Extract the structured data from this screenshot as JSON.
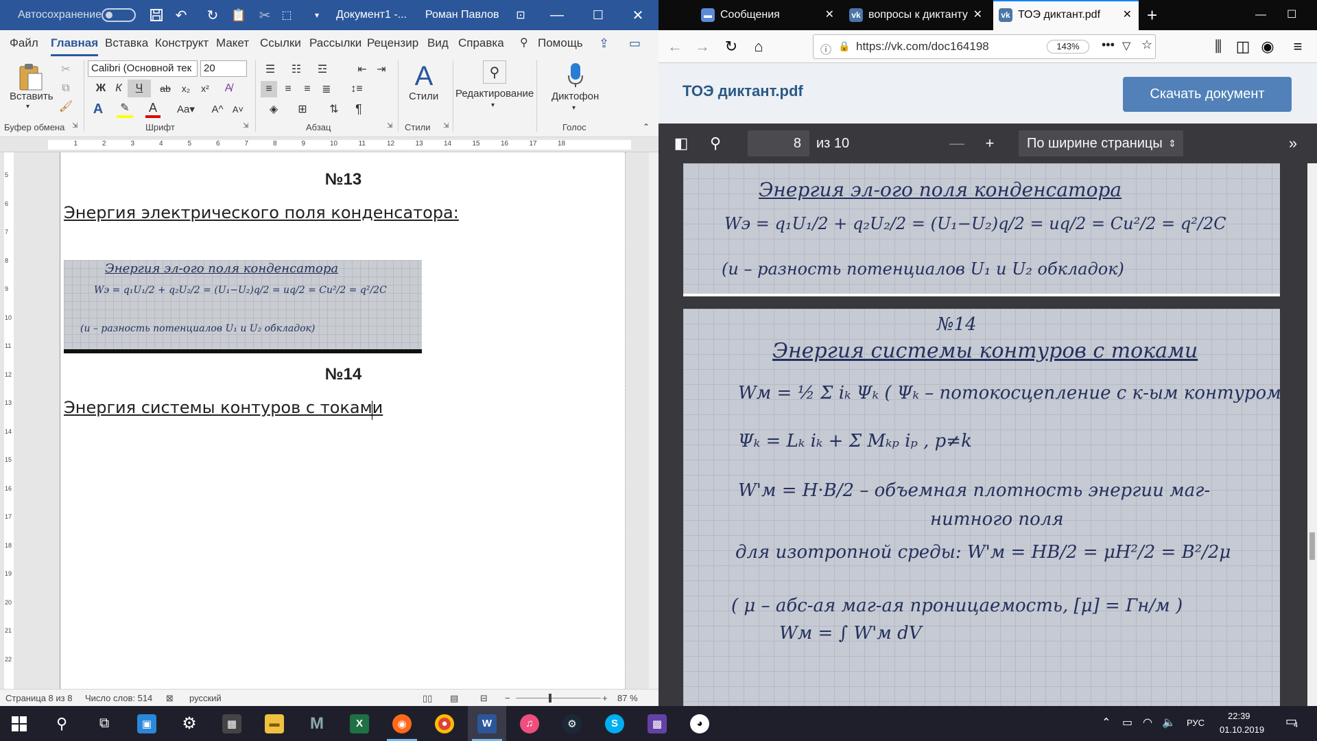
{
  "word": {
    "autosave_label": "Автосохранение",
    "doc_title": "Документ1  -...",
    "user_name": "Роман Павлов",
    "tabs": [
      "Файл",
      "Главная",
      "Вставка",
      "Конструкт",
      "Макет",
      "Ссылки",
      "Рассылки",
      "Рецензир",
      "Вид",
      "Справка",
      "Помощь"
    ],
    "active_tab": "Главная",
    "ribbon": {
      "paste_label": "Вставить",
      "font_name": "Calibri (Основной тек",
      "font_size": "20",
      "bold": "Ж",
      "italic": "К",
      "underline": "Ч",
      "styles_label": "Стили",
      "editing_label": "Редактирование",
      "dictate_label": "Диктофон",
      "groups": [
        "Буфер обмена",
        "Шрифт",
        "Абзац",
        "Стили",
        "Голос"
      ]
    },
    "document": {
      "heading1": "№13",
      "line1": "Энергия электрического поля конденсатора:",
      "heading2": "№14",
      "line2": "Энергия системы контуров с токами"
    },
    "status": {
      "page": "Страница 8 из 8",
      "words": "Число слов: 514",
      "language": "русский",
      "zoom": "87 %"
    }
  },
  "browser": {
    "tabs": [
      {
        "label": "Сообщения",
        "active": false
      },
      {
        "label": "вопросы к диктанту",
        "active": false
      },
      {
        "label": "ТОЭ диктант.pdf",
        "active": true
      }
    ],
    "url": "https://vk.com/doc164198",
    "zoom": "143%",
    "file_title": "ТОЭ диктант.pdf",
    "download_button": "Скачать документ",
    "pdf": {
      "page": "8",
      "of": "из 10",
      "scale": "По ширине страницы"
    },
    "note13": {
      "title": "Энергия эл-ого поля конденсатора",
      "formula": "Wэ = q₁U₁/2 + q₂U₂/2 = (U₁−U₂)q/2 = uq/2 = Cu²/2 = q²/2C",
      "note": "(u – разность потенциалов U₁ и U₂ обкладок)"
    },
    "note14": {
      "number": "№14",
      "title": "Энергия системы контуров с токами",
      "line1": "Wм = ½ Σ iₖ Ψₖ  ( Ψₖ – потокосцепление с к-ым контуром",
      "line2": "Ψₖ = Lₖ iₖ + Σ Mₖₚ iₚ , p≠k",
      "line3": "W'м = H·B/2  – объемная плотность энергии маг-",
      "line3b": "нитного поля",
      "line4": "для изотропной среды:  W'м = HB/2 = μH²/2 = B²/2μ",
      "line5": "( μ – абс-ая маг-ая проницаемость, [μ] = Гн/м )",
      "line6": "Wм = ∫ W'м dV"
    }
  },
  "taskbar": {
    "language": "РУС",
    "time": "22:39",
    "date": "01.10.2019",
    "notifications": "4"
  }
}
